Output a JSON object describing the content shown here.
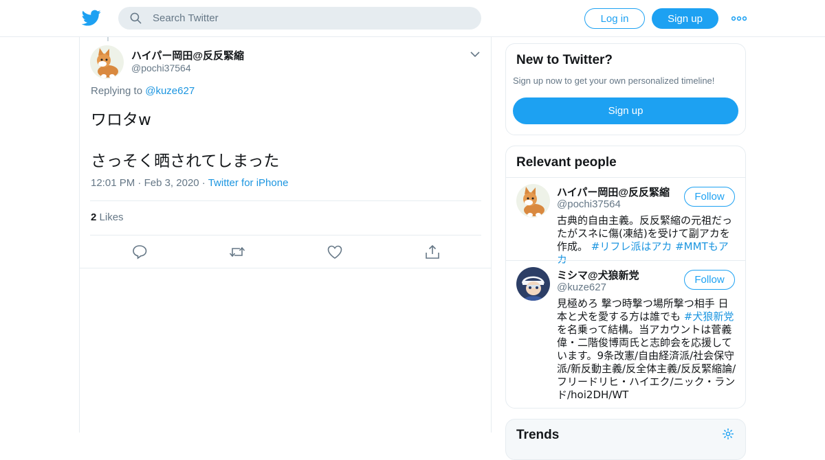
{
  "header": {
    "search_placeholder": "Search Twitter",
    "login_label": "Log in",
    "signup_label": "Sign up",
    "brand_color": "#1da1f2"
  },
  "tweet": {
    "name": "ハイパー岡田@反反緊縮",
    "handle": "@pochi37564",
    "replying_prefix": "Replying to",
    "replying_to": "@kuze627",
    "text_line1": "ワロタw",
    "text_line2": "さっそく晒されてしまった",
    "time": "12:01 PM",
    "date": "Feb 3, 2020",
    "source": "Twitter for iPhone",
    "likes_count": "2",
    "likes_label": "Likes"
  },
  "sidebar": {
    "new_title": "New to Twitter?",
    "new_text": "Sign up now to get your own personalized timeline!",
    "new_button": "Sign up",
    "relevant_title": "Relevant people",
    "people": [
      {
        "name": "ハイパー岡田@反反緊縮",
        "handle": "@pochi37564",
        "follow_label": "Follow",
        "bio_text": "古典的自由主義。反反緊縮の元祖だったがスネに傷(凍結)を受けて副アカを作成。 ",
        "bio_tags": "#リフレ派はアカ #MMTもアカ"
      },
      {
        "name": "ミシマ@犬狼新党",
        "handle": "@kuze627",
        "follow_label": "Follow",
        "bio_part1": "見極めろ 撃つ時撃つ場所撃つ相手 日本と犬を愛する方は誰でも ",
        "bio_tag": "#犬狼新党",
        "bio_part2": " を名乗って結構。当アカウントは菅義偉・二階俊博両氏と志帥会を応援しています。9条改憲/自由経済派/社会保守派/新反動主義/反全体主義/反反緊縮論/フリードリヒ・ハイエク/ニック・ランド/hoi2DH/WT"
      }
    ],
    "trends_title": "Trends"
  },
  "icons": [
    "twitter-bird-icon",
    "search-icon",
    "more-dots-icon",
    "caret-down-icon",
    "reply-icon",
    "retweet-icon",
    "like-icon",
    "share-icon",
    "gear-icon"
  ]
}
